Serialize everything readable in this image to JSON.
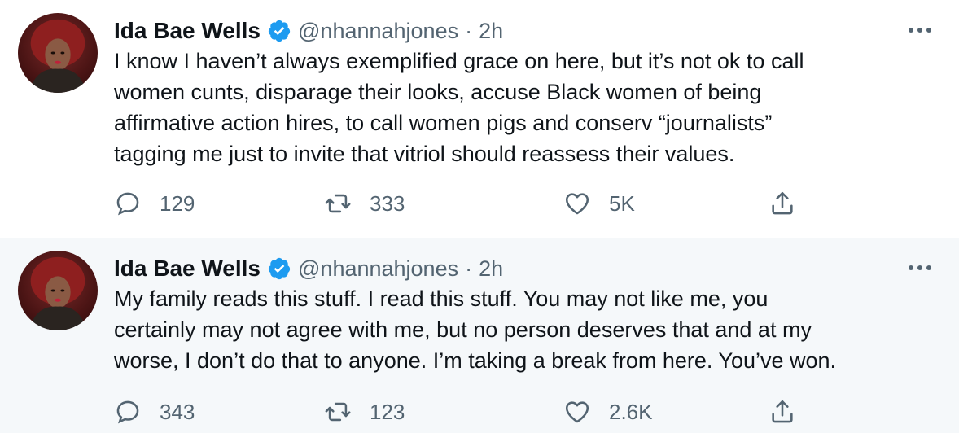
{
  "tweets": [
    {
      "author": {
        "name": "Ida Bae Wells",
        "handle": "@nhannahjones",
        "verified": true
      },
      "separator": "·",
      "time": "2h",
      "text": "I know I haven’t always exemplified grace on here, but it’s not ok to call\nwomen cunts, disparage their looks, accuse Black women of being\naffirmative action hires, to call women pigs and conserv “journalists”\ntagging me just to invite that vitriol should reassess their values.",
      "actions": {
        "replies": "129",
        "retweets": "333",
        "likes": "5K"
      }
    },
    {
      "author": {
        "name": "Ida Bae Wells",
        "handle": "@nhannahjones",
        "verified": true
      },
      "separator": "·",
      "time": "2h",
      "text": "My family reads this stuff. I read this stuff. You may not like me, you\ncertainly may not agree with me, but no person deserves that and at my\nworse, I don’t do that to anyone. I’m taking a break from here. You’ve won.",
      "actions": {
        "replies": "343",
        "retweets": "123",
        "likes": "2.6K"
      }
    }
  ],
  "icons": {
    "verified": "verified-badge-icon",
    "more": "more-options-icon",
    "reply": "reply-icon",
    "retweet": "retweet-icon",
    "like": "heart-icon",
    "share": "share-icon"
  },
  "colors": {
    "verified_blue": "#1d9bf0",
    "text_primary": "#0f1419",
    "text_secondary": "#536471",
    "thread_line": "#c4cfd6",
    "highlight_bg": "#f5f8fa"
  }
}
